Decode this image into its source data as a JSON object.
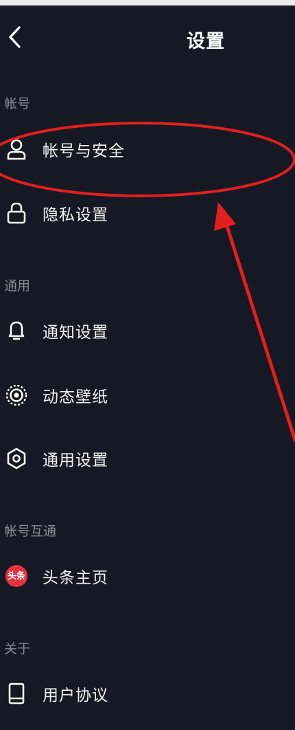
{
  "header": {
    "title": "设置",
    "back_icon": "chevron-left-icon"
  },
  "sections": {
    "account": {
      "label": "帐号",
      "items": [
        {
          "label": "帐号与安全",
          "icon": "user-icon"
        },
        {
          "label": "隐私设置",
          "icon": "lock-icon"
        }
      ]
    },
    "general": {
      "label": "通用",
      "items": [
        {
          "label": "通知设置",
          "icon": "bell-icon"
        },
        {
          "label": "动态壁纸",
          "icon": "live-wallpaper-icon"
        },
        {
          "label": "通用设置",
          "icon": "gear-icon"
        }
      ]
    },
    "linked": {
      "label": "帐号互通",
      "items": [
        {
          "label": "头条主页",
          "icon": "toutiao-icon",
          "badge_text": "头条"
        }
      ]
    },
    "about": {
      "label": "关于",
      "items": [
        {
          "label": "用户协议",
          "icon": "book-icon"
        }
      ]
    }
  },
  "colors": {
    "background": "#161823",
    "text": "#f2f2f2",
    "section_label": "#8a8b91",
    "annotation_red": "#e0201c",
    "toutiao_red": "#e8313e"
  }
}
